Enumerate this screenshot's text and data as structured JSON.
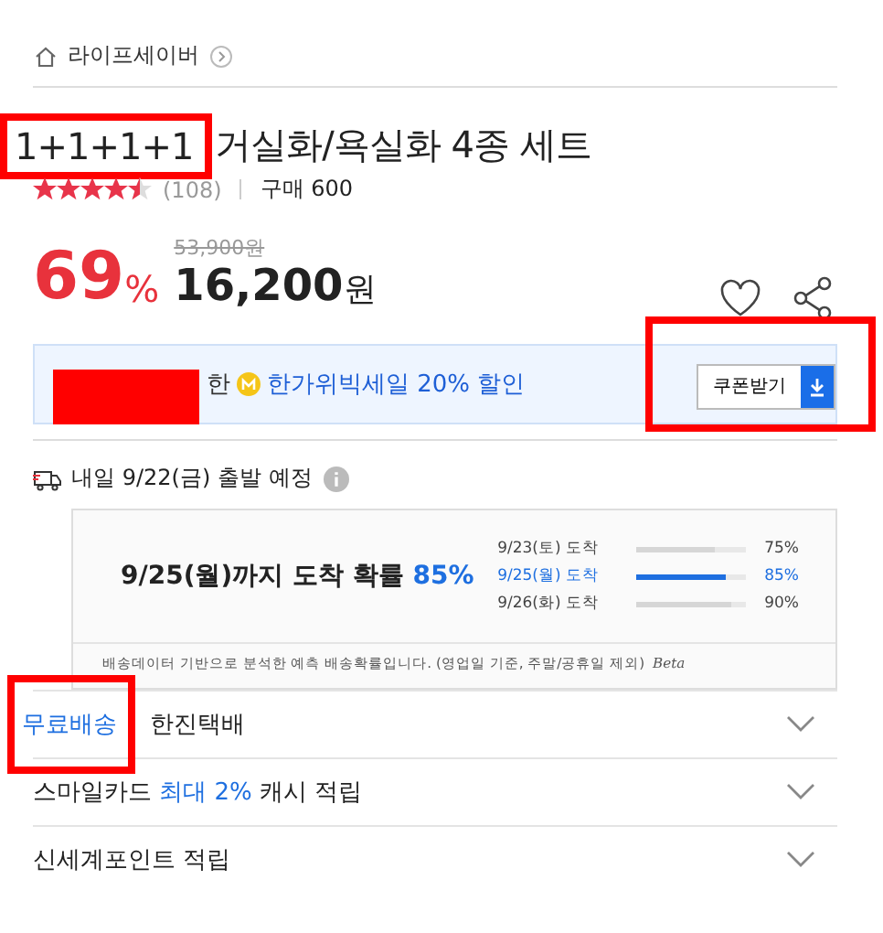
{
  "breadcrumb": {
    "label": "라이프세이버"
  },
  "title": [
    {
      "text": "1+1+1+1",
      "highlighted": true
    },
    {
      "text": "거실화/욕실화 4종 세트",
      "highlighted": false
    }
  ],
  "rating": {
    "stars": 4.5,
    "count": "(108)",
    "purchases": "구매 600"
  },
  "price": {
    "discount": "69",
    "percent": "%",
    "original": "53,900원",
    "amount": "16,200",
    "unit": "원"
  },
  "coupon": {
    "redacted": true,
    "suffix": "한",
    "text": "한가위빅세일 20% 할인",
    "button": "쿠폰받기",
    "highlighted": true
  },
  "shipping": {
    "departure": "내일 9/22(금) 출발 예정",
    "headline": "9/25(월)까지 도착 확률",
    "headline_rate": "85%",
    "rows": [
      {
        "label": "9/23(토) 도착",
        "level": 0.72,
        "reading": "75%",
        "selected": false
      },
      {
        "label": "9/25(월) 도착",
        "level": 0.82,
        "reading": "85%",
        "selected": true
      },
      {
        "label": "9/26(화) 도착",
        "level": 0.87,
        "reading": "90%",
        "selected": false
      }
    ],
    "note": "배송데이터 기반으로 분석한 예측 배송확률입니다. (영업일 기준, 주말/공휴일 제외)",
    "beta": "Beta"
  },
  "benefits": [
    {
      "label": "무료배송",
      "text": "한진택배",
      "highlighted": true
    },
    {
      "text": "스마일카드 **최대 2%** 캐시 적립",
      "highlighted": false
    },
    {
      "text": "신세계포인트 적립",
      "highlighted": false
    }
  ]
}
